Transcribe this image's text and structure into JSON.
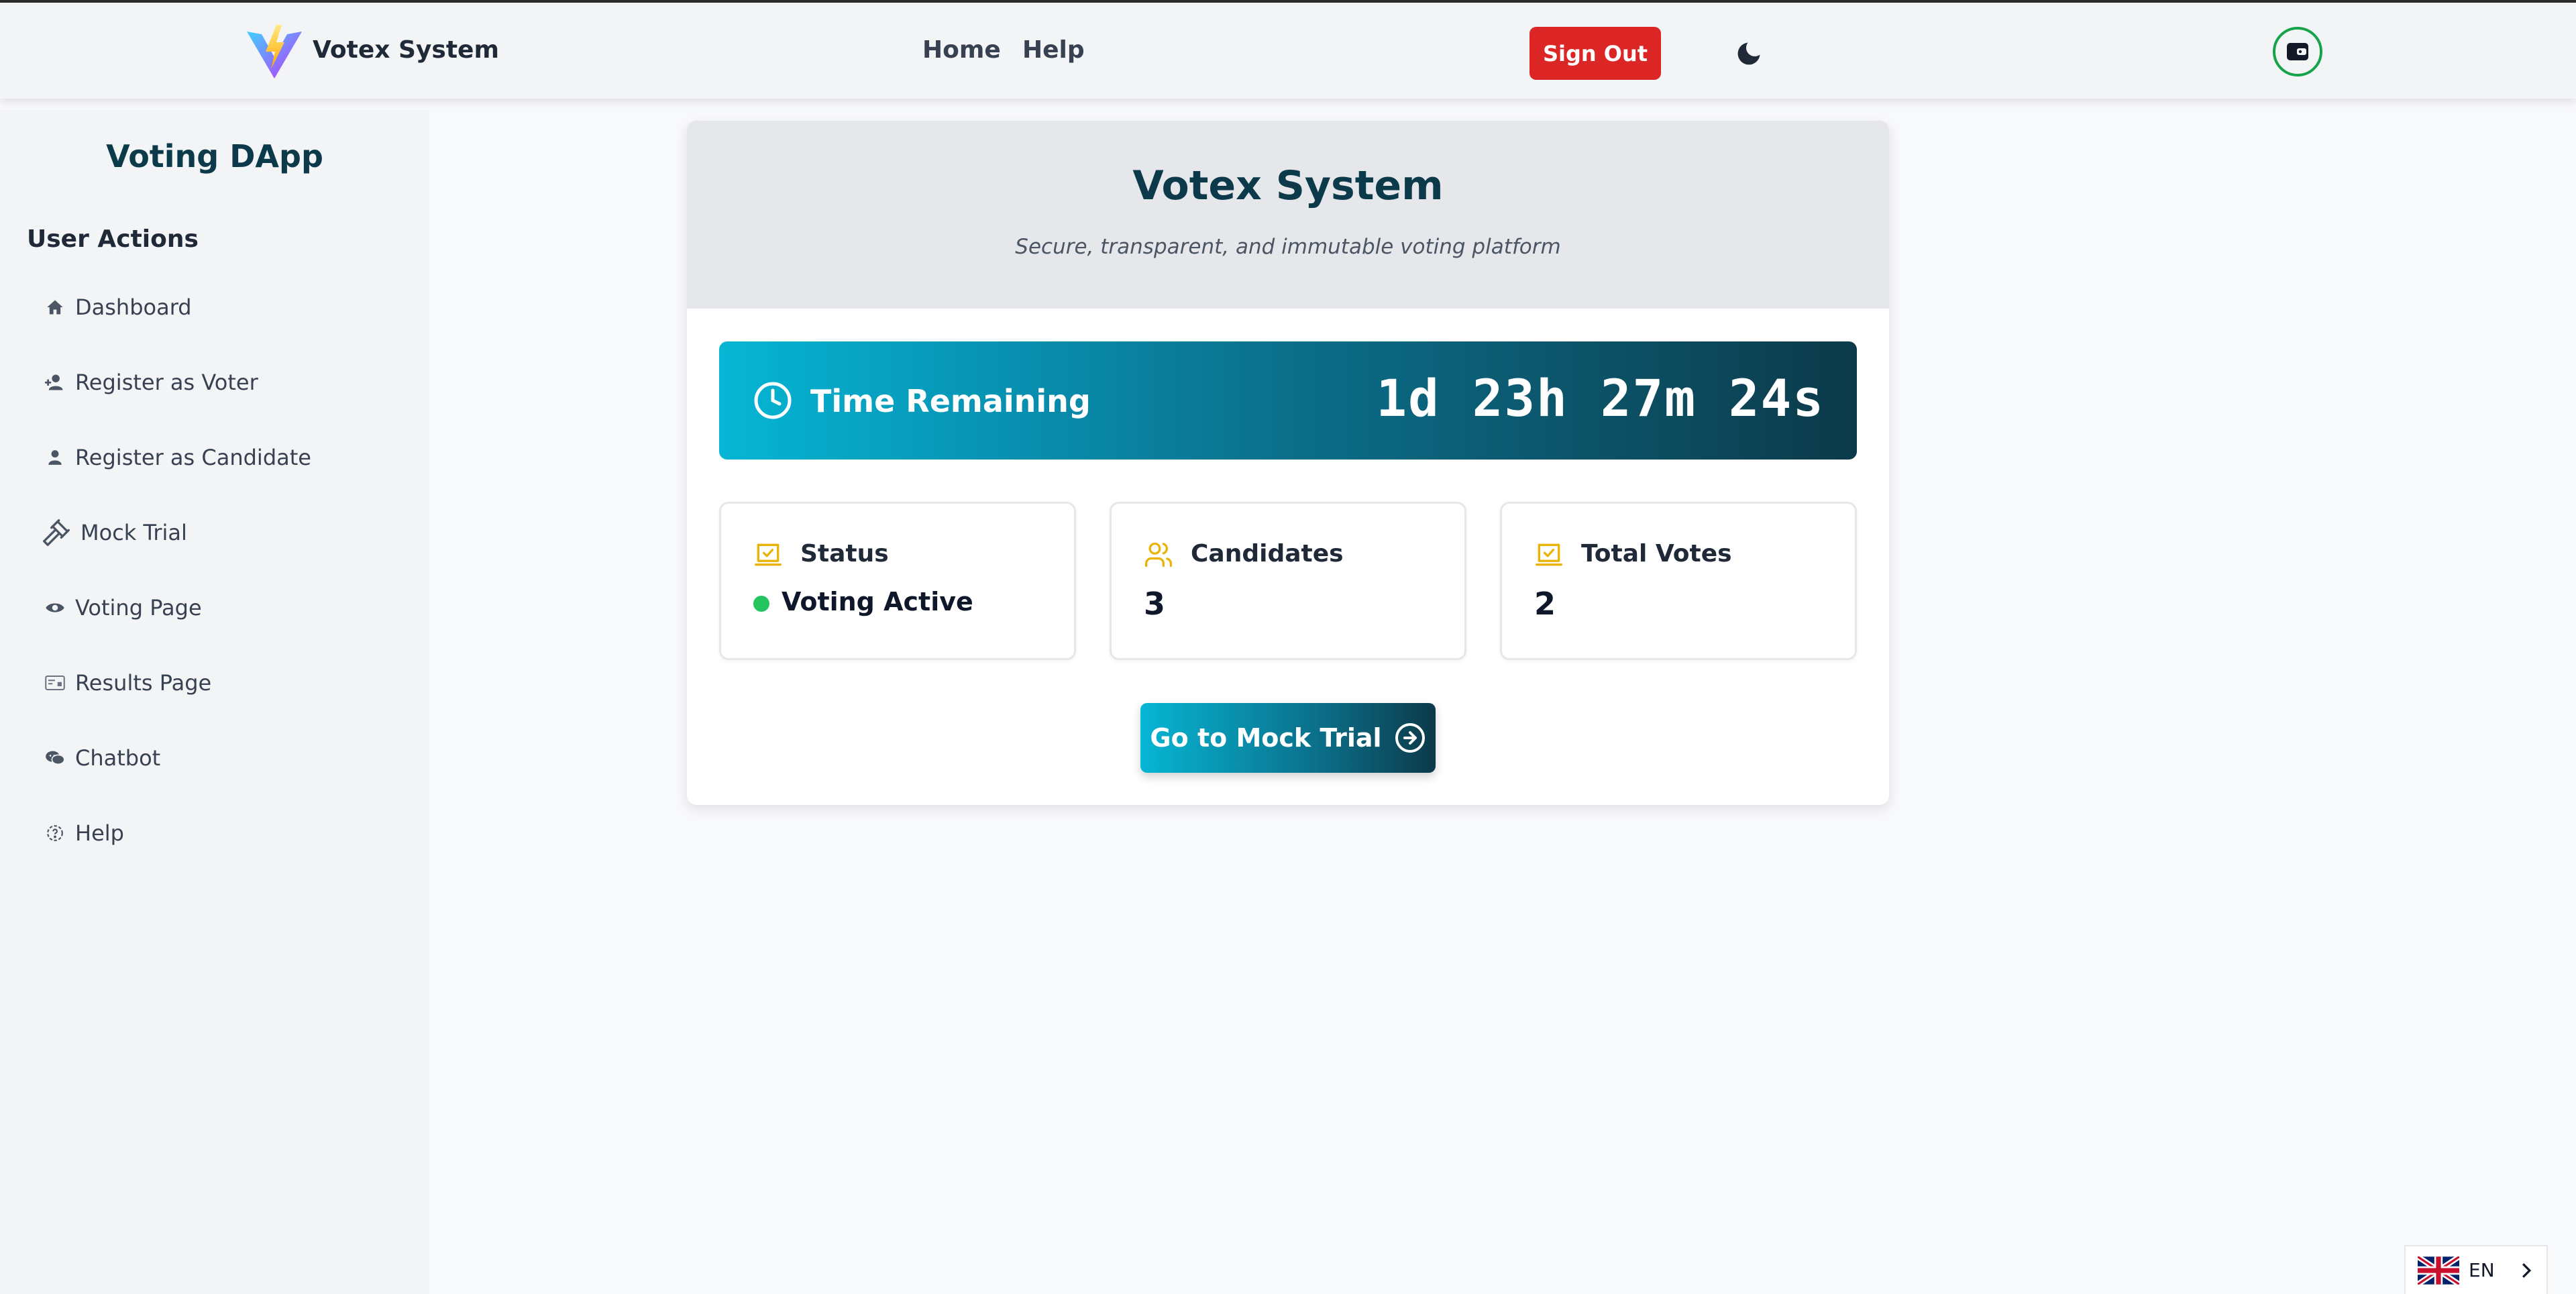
{
  "navbar": {
    "brand": "Votex System",
    "links": [
      "Home",
      "Help"
    ],
    "sign_out": "Sign Out",
    "icons": {
      "logo": "vite-lightning-logo",
      "theme": "moon-icon",
      "wallet": "wallet-icon"
    }
  },
  "sidebar": {
    "title": "Voting DApp",
    "section": "User Actions",
    "items": [
      {
        "label": "Dashboard",
        "icon": "home-icon"
      },
      {
        "label": "Register as Voter",
        "icon": "user-plus-icon"
      },
      {
        "label": "Register as Candidate",
        "icon": "user-icon"
      },
      {
        "label": "Mock Trial",
        "icon": "gavel-icon"
      },
      {
        "label": "Voting Page",
        "icon": "eye-icon"
      },
      {
        "label": "Results Page",
        "icon": "card-icon"
      },
      {
        "label": "Chatbot",
        "icon": "chat-icon"
      },
      {
        "label": "Help",
        "icon": "help-icon"
      }
    ]
  },
  "main": {
    "title": "Votex System",
    "subtitle": "Secure, transparent, and immutable voting platform",
    "timer": {
      "label": "Time Remaining",
      "value": "1d 23h 27m 24s"
    },
    "stats": {
      "status": {
        "label": "Status",
        "value": "Voting Active"
      },
      "candidates": {
        "label": "Candidates",
        "value": "3"
      },
      "votes": {
        "label": "Total Votes",
        "value": "2"
      }
    },
    "cta": "Go to Mock Trial"
  },
  "language": {
    "code": "EN",
    "flag": "uk-flag-icon"
  },
  "colors": {
    "accent": "#06b6d4",
    "dark": "#0c3a4a",
    "danger": "#dc2626",
    "success": "#22c55e",
    "warning_icon": "#eab308"
  }
}
